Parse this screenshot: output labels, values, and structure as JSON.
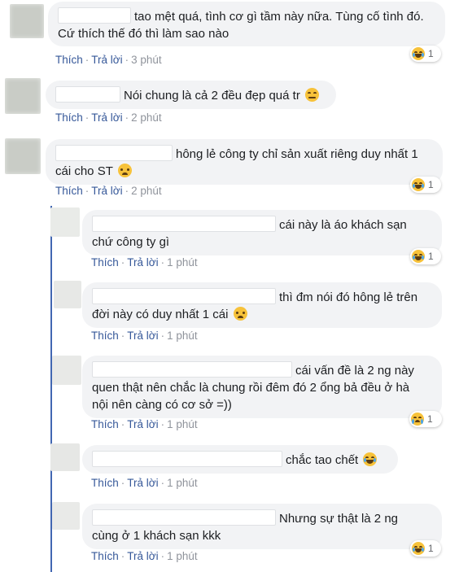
{
  "comments": [
    {
      "text_line1": "tao mệt quá, tình cơ gì tầm này nữa. Tùng cố tình đó.",
      "text_line2": "Cứ thích thế đó thì làm sao nào",
      "like": "Thích",
      "reply": "Trả lời",
      "time": "3 phút",
      "reaction": {
        "icon": "laugh-cry-icon",
        "count": "1"
      }
    },
    {
      "text_line1": "Nói chung là cả 2 đều đẹp quá tr",
      "like": "Thích",
      "reply": "Trả lời",
      "time": "2 phút",
      "inline_emoji": "smirk-icon"
    },
    {
      "text_line1": "hông lẻ công ty chỉ sản xuất riêng duy nhất 1",
      "text_line2": "cái cho ST",
      "like": "Thích",
      "reply": "Trả lời",
      "time": "2 phút",
      "inline_emoji": "worried-icon",
      "reaction": {
        "icon": "laugh-cry-icon",
        "count": "1"
      }
    }
  ],
  "replies": [
    {
      "text_line1": "cái này là áo khách sạn",
      "text_line2": "chứ công ty gì",
      "like": "Thích",
      "reply": "Trả lời",
      "time": "1 phút",
      "reaction": {
        "icon": "laugh-cry-icon",
        "count": "1"
      }
    },
    {
      "text_line1": "thì đm nói đó hông lẻ trên",
      "text_line2": "đời này có duy nhất 1 cái",
      "like": "Thích",
      "reply": "Trả lời",
      "time": "1 phút",
      "inline_emoji": "worried-icon"
    },
    {
      "text_line1": "cái vấn đề là 2 ng này",
      "text_line2": "quen thật nên chắc là chung rồi đêm đó 2 ổng bả đều ở hà",
      "text_line3": "nội nên càng có cơ sở =))",
      "like": "Thích",
      "reply": "Trả lời",
      "time": "1 phút",
      "reaction": {
        "icon": "crying-icon",
        "count": "1"
      }
    },
    {
      "text_line1": "chắc tao chết",
      "like": "Thích",
      "reply": "Trả lời",
      "time": "1 phút",
      "inline_emoji": "laugh-cry-icon"
    },
    {
      "text_line1": "Nhưng sự thật là 2 ng",
      "text_line2": "cùng ở 1 khách sạn kkk",
      "like": "Thích",
      "reply": "Trả lời",
      "time": "1 phút",
      "reaction": {
        "icon": "laugh-cry-icon",
        "count": "1"
      }
    }
  ],
  "separator": "·",
  "colors": {
    "bubble": "#f2f3f5",
    "link": "#365899",
    "muted": "#90949c",
    "thread": "#4267b2"
  }
}
